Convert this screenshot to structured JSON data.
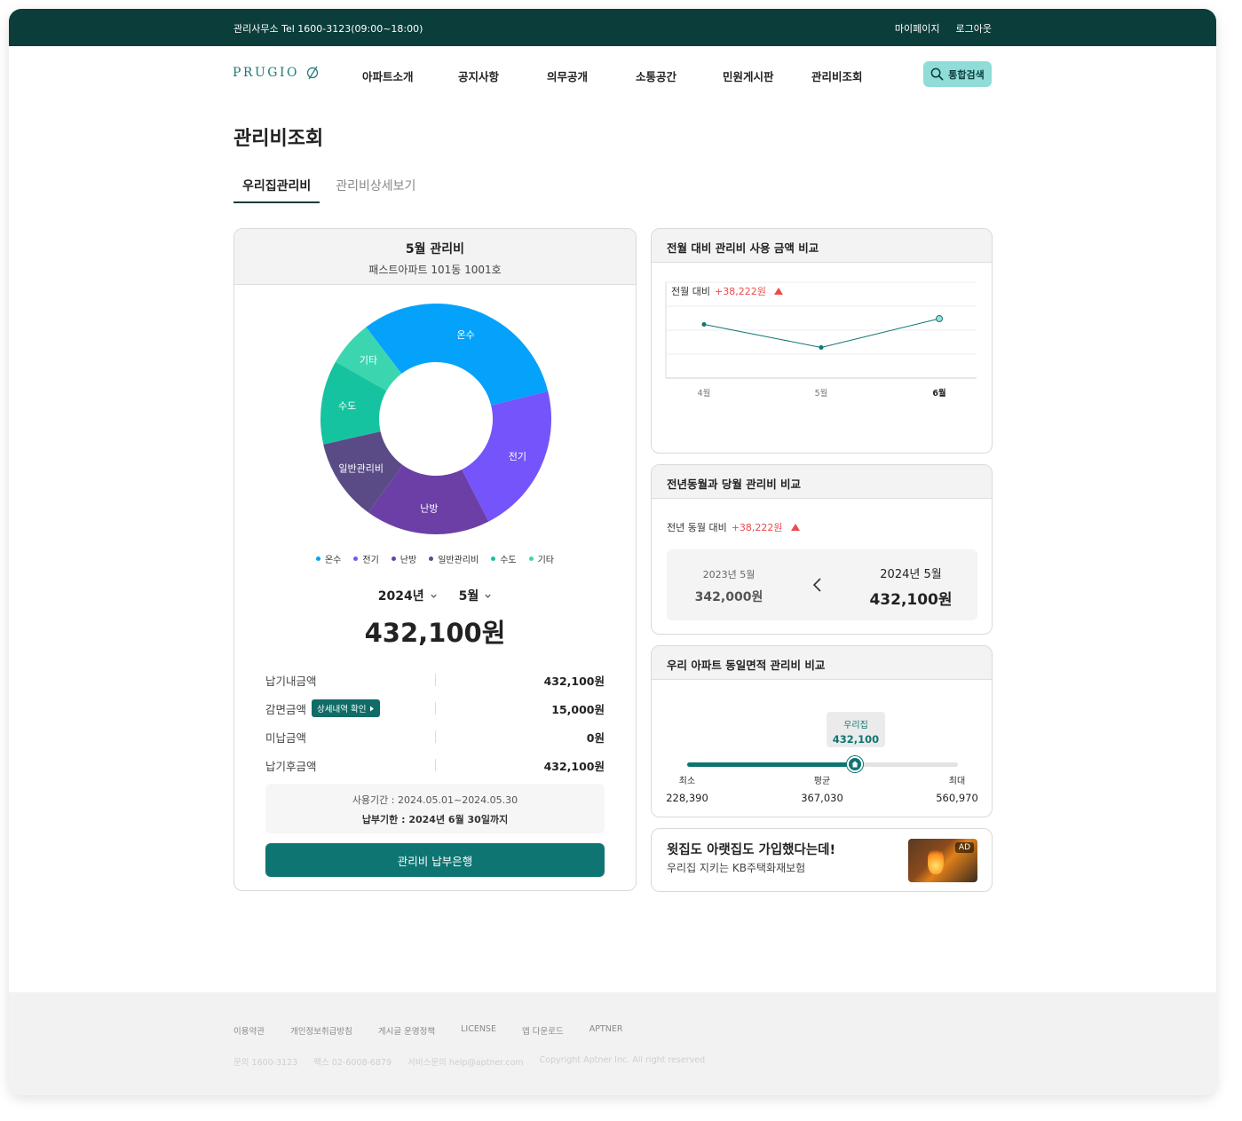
{
  "topbar": {
    "office": "관리사무소 Tel 1600-3123(09:00~18:00)",
    "mypage": "마이페이지",
    "logout": "로그아웃"
  },
  "header": {
    "logo": "PRUGIO",
    "nav": [
      "아파트소개",
      "공지사항",
      "의무공개",
      "소통공간",
      "민원게시판",
      "관리비조회"
    ],
    "search_label": "통합검색"
  },
  "page": {
    "title": "관리비조회",
    "tabs": [
      {
        "label": "우리집관리비",
        "active": true
      },
      {
        "label": "관리비상세보기",
        "active": false
      }
    ]
  },
  "bill": {
    "title": "5월 관리비",
    "address": "패스트아파트 101동 1001호",
    "year_select": "2024년",
    "month_select": "5월",
    "total": "432,100원",
    "rows": [
      {
        "label": "납기내금액",
        "value": "432,100원"
      },
      {
        "label": "감면금액",
        "value": "15,000원",
        "button": "상세내역 확인"
      },
      {
        "label": "미납금액",
        "value": "0원"
      },
      {
        "label": "납기후금액",
        "value": "432,100원"
      }
    ],
    "period": "사용기간 : 2024.05.01~2024.05.30",
    "due": "납부기한 : 2024년 6월 30일까지",
    "pay_button": "관리비 납부은행"
  },
  "donut": {
    "segments": [
      {
        "label": "온수",
        "color": "#05a2fb",
        "share": 0.315
      },
      {
        "label": "전기",
        "color": "#7554fb",
        "share": 0.213
      },
      {
        "label": "난방",
        "color": "#6c3fa6",
        "share": 0.175
      },
      {
        "label": "일반관리비",
        "color": "#5a4b86",
        "share": 0.115
      },
      {
        "label": "수도",
        "color": "#16c3a0",
        "share": 0.118
      },
      {
        "label": "기타",
        "color": "#3bd6b0",
        "share": 0.064
      }
    ]
  },
  "monthly_compare": {
    "title": "전월 대비 관리비 사용 금액 비교",
    "label": "전월 대비",
    "diff": "+38,222원",
    "chart_data": {
      "type": "line",
      "categories": [
        "4월",
        "5월",
        "6월"
      ],
      "values": [
        396000,
        372000,
        402000
      ],
      "ylim": [
        340000,
        440000
      ],
      "grid": true
    }
  },
  "yearly_compare": {
    "title": "전년동월과 당월 관리비 비교",
    "label": "전년 동월 대비",
    "diff": "+38,222원",
    "prev_label": "2023년 5월",
    "prev_value": "342,000원",
    "cur_label": "2024년 5월",
    "cur_value": "432,100원"
  },
  "area_compare": {
    "title": "우리 아파트 동일면적 관리비 비교",
    "ours_label": "우리집",
    "ours_value": "432,100",
    "position": 0.62,
    "min_label": "최소",
    "min_value": "228,390",
    "avg_label": "평균",
    "avg_value": "367,030",
    "max_label": "최대",
    "max_value": "560,970"
  },
  "ad": {
    "title": "윗집도 아랫집도 가입했다는데!",
    "subtitle": "우리집 지키는 KB주택화재보험",
    "badge": "AD"
  },
  "footer": {
    "links": [
      "이용약관",
      "개인정보취급방침",
      "게시글 운영정책",
      "LICENSE",
      "앱 다운로드",
      "APTNER"
    ],
    "info": [
      "문의 1600-3123",
      "팩스 02-6008-6879",
      "서비스문의 help@aptner.com",
      "Copyright Aptner Inc. All right reserved"
    ]
  },
  "colors": {
    "brand_dark": "#0b3d3b",
    "brand": "#0f7572",
    "accent": "#8fdcd8",
    "up": "#ef4a4a"
  }
}
